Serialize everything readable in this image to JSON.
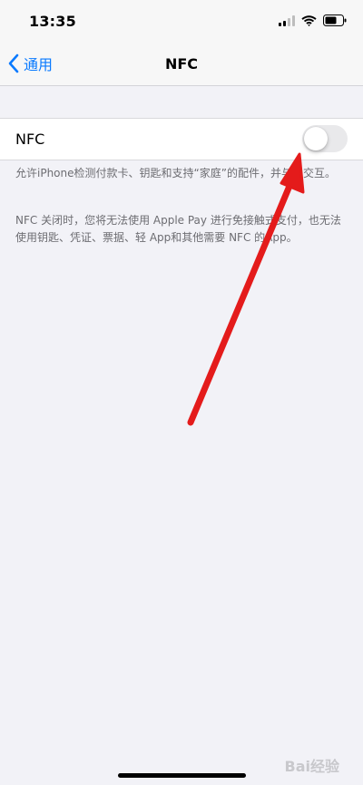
{
  "status_bar": {
    "time": "13:35",
    "icons": [
      "signal-icon",
      "wifi-icon",
      "battery-icon"
    ]
  },
  "nav": {
    "back_label": "通用",
    "title": "NFC"
  },
  "nfc_setting": {
    "label": "NFC",
    "toggle_state": "off"
  },
  "footer": {
    "line1": "允许iPhone检测付款卡、钥匙和支持“家庭”的配件，并与之交互。",
    "line2": "NFC 关闭时，您将无法使用 Apple Pay 进行免接触式支付，也无法使用钥匙、凭证、票据、轻 App和其他需要 NFC 的App。"
  },
  "annotation": {
    "arrow_color": "#e41b1b"
  },
  "watermark": {
    "text": "Bai经验"
  },
  "colors": {
    "accent": "#0a7aff",
    "background": "#f2f2f7",
    "toggle_off": "#e9e9eb"
  }
}
